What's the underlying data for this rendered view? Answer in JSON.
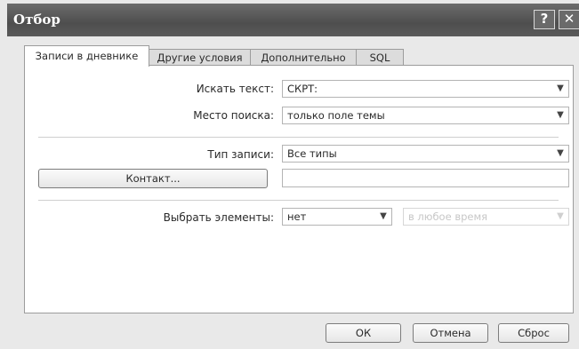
{
  "window": {
    "title": "Отбор",
    "help_glyph": "?",
    "close_glyph": "✕"
  },
  "tabs": [
    {
      "label": "Записи в дневнике",
      "active": true
    },
    {
      "label": "Другие условия",
      "active": false
    },
    {
      "label": "Дополнительно",
      "active": false
    },
    {
      "label": "SQL",
      "active": false
    }
  ],
  "form": {
    "search_text_label": "Искать текст:",
    "search_text_value": "СКРТ:",
    "search_in_label": "Место поиска:",
    "search_in_value": "только поле темы",
    "entry_type_label": "Тип записи:",
    "entry_type_value": "Все типы",
    "contacts_button": "Контакт...",
    "contacts_value": "",
    "select_items_label": "Выбрать элементы:",
    "select_items_value": "нет",
    "time_value": "в любое время",
    "dropdown_glyph": "▼"
  },
  "footer": {
    "ok": "ОК",
    "cancel": "Отмена",
    "reset": "Сброс"
  }
}
